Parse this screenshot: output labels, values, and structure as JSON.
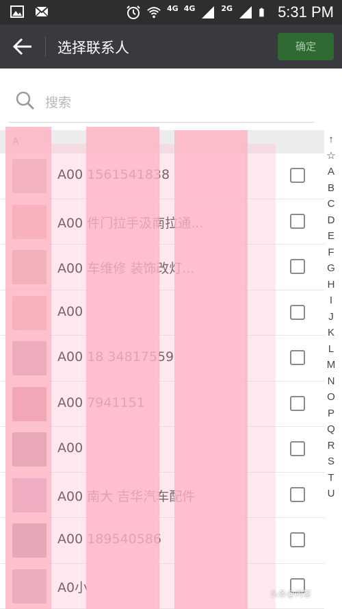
{
  "status_bar": {
    "network_label": "4G",
    "signal1_label": "4G",
    "signal2_label": "2G",
    "time": "5:31 PM"
  },
  "header": {
    "title": "选择联系人",
    "confirm_label": "确定"
  },
  "search": {
    "placeholder": "搜索"
  },
  "section": {
    "letter": "A"
  },
  "contacts": [
    {
      "name": "A00 1561541838",
      "avatar_color": "#c9bdbd"
    },
    {
      "name": "A00 件门拉手汲南拉通...",
      "avatar_color": "#d8b9b0"
    },
    {
      "name": "A00 车维修 装饰改灯...",
      "avatar_color": "#bdb0a6"
    },
    {
      "name": "A00",
      "avatar_color": "#e2b6b6"
    },
    {
      "name": "A00 18 34817559",
      "avatar_color": "#a9a0a8"
    },
    {
      "name": "A00 7941151",
      "avatar_color": "#c68a93"
    },
    {
      "name": "A00",
      "avatar_color": "#9c8c96"
    },
    {
      "name": "A00 南大 吉华汽车配件",
      "avatar_color": "#b7a6c2"
    },
    {
      "name": "A00 189540586",
      "avatar_color": "#8d8a98"
    },
    {
      "name": "A0小",
      "avatar_color": "#a9a9b6"
    }
  ],
  "index_letters": [
    "↑",
    "☆",
    "A",
    "B",
    "C",
    "D",
    "E",
    "F",
    "G",
    "H",
    "I",
    "J",
    "K",
    "L",
    "M",
    "N",
    "O",
    "P",
    "Q",
    "R",
    "S",
    "T",
    "U"
  ],
  "watermark": "头条@问答",
  "colors": {
    "status_bar": "#2e2e2e",
    "title_bar": "#393a3f",
    "confirm_button": "#2f6a33",
    "redaction": "#ffb0c0"
  }
}
